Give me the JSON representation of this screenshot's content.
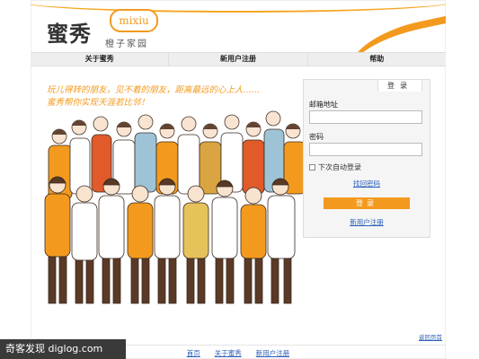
{
  "header": {
    "logo_text": "蜜秀",
    "logo_bubble": "mixiu",
    "logo_sub": "橙子家园"
  },
  "nav": {
    "items": [
      "关于蜜秀",
      "新用户注册",
      "帮助"
    ]
  },
  "tagline": {
    "line1": "玩儿得转的朋友，见不着的朋友，距离最远的心上人……",
    "line2": "蜜秀帮你实现天涯若比邻！"
  },
  "login": {
    "tab_label": "登录",
    "email_label": "邮箱地址",
    "email_value": "",
    "password_label": "密码",
    "password_value": "",
    "remember_label": "下次自动登录",
    "forgot_label": "找回密码",
    "submit_label": "登录",
    "register_label": "新用户注册"
  },
  "footer": {
    "top_note": "返回页首",
    "links": [
      "首页",
      "关于蜜秀",
      "新用户注册"
    ]
  },
  "watermark": "奇客发现 diglog.com",
  "colors": {
    "accent": "#f39a1e",
    "link": "#2b5fb8"
  }
}
